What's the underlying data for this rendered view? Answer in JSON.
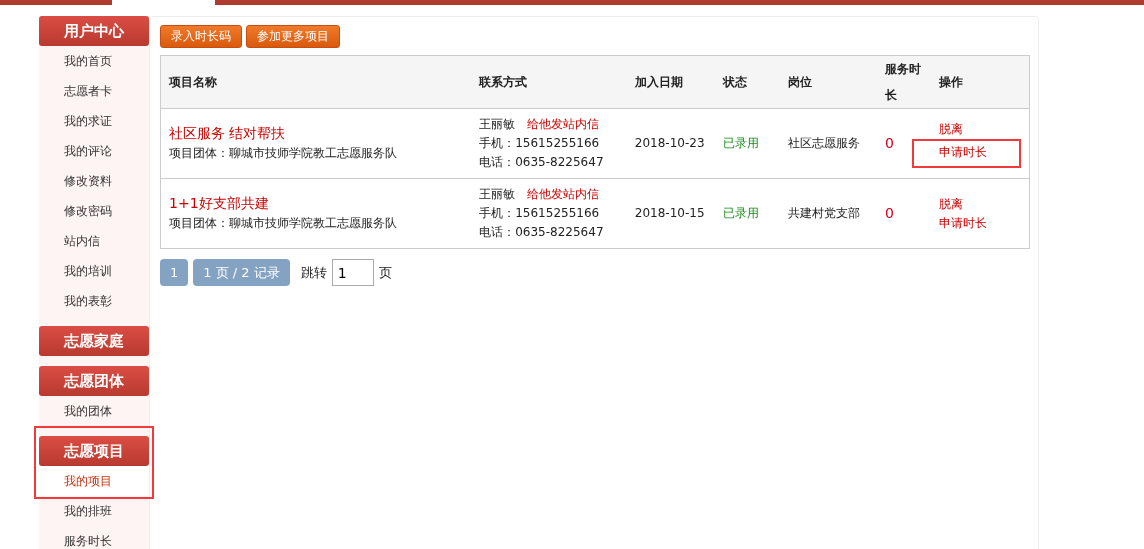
{
  "sidebar": [
    {
      "title": "用户中心",
      "highlighted": false,
      "items": [
        {
          "label": "我的首页",
          "selected": false
        },
        {
          "label": "志愿者卡",
          "selected": false
        },
        {
          "label": "我的求证",
          "selected": false
        },
        {
          "label": "我的评论",
          "selected": false
        },
        {
          "label": "修改资料",
          "selected": false
        },
        {
          "label": "修改密码",
          "selected": false
        },
        {
          "label": "站内信",
          "selected": false
        },
        {
          "label": "我的培训",
          "selected": false
        },
        {
          "label": "我的表彰",
          "selected": false
        }
      ]
    },
    {
      "title": "志愿家庭",
      "highlighted": false
    },
    {
      "title": "志愿团体",
      "highlighted": false,
      "items": [
        {
          "label": "我的团体",
          "selected": false
        }
      ]
    },
    {
      "title": "志愿项目",
      "highlighted": true,
      "items": [
        {
          "label": "我的项目",
          "selected": true
        },
        {
          "label": "我的排班",
          "selected": false
        },
        {
          "label": "服务时长",
          "selected": false
        }
      ]
    }
  ],
  "toolbar": [
    "录入时长码",
    "参加更多项目"
  ],
  "table": {
    "columns": [
      "项目名称",
      "联系方式",
      "加入日期",
      "状态",
      "岗位",
      "服务时长",
      "操作"
    ],
    "rows": [
      {
        "project": "社区服务 结对帮扶",
        "team": "项目团体：聊城市技师学院教工志愿服务队",
        "contact": "王丽敏",
        "message": "给他发站内信",
        "mobile": "手机：15615255166",
        "phone": "电话：0635-8225647",
        "date": "2018-10-23",
        "status": "已录用",
        "position": "社区志愿服务",
        "hours": "0",
        "actions": [
          {
            "label": "脱离",
            "highlighted": false
          },
          {
            "label": "申请时长",
            "highlighted": true
          }
        ]
      },
      {
        "project": "1+1好支部共建",
        "team": "项目团体：聊城市技师学院教工志愿服务队",
        "contact": "王丽敏",
        "message": "给他发站内信",
        "mobile": "手机：15615255166",
        "phone": "电话：0635-8225647",
        "date": "2018-10-15",
        "status": "已录用",
        "position": "共建村党支部",
        "hours": "0",
        "actions": [
          {
            "label": "脱离",
            "highlighted": false
          },
          {
            "label": "申请时长",
            "highlighted": false
          }
        ]
      }
    ]
  },
  "pagination": {
    "page": "1",
    "summary": "1 页 / 2 记录",
    "jump_label": "跳转",
    "jump_value": "1",
    "unit": "页"
  }
}
